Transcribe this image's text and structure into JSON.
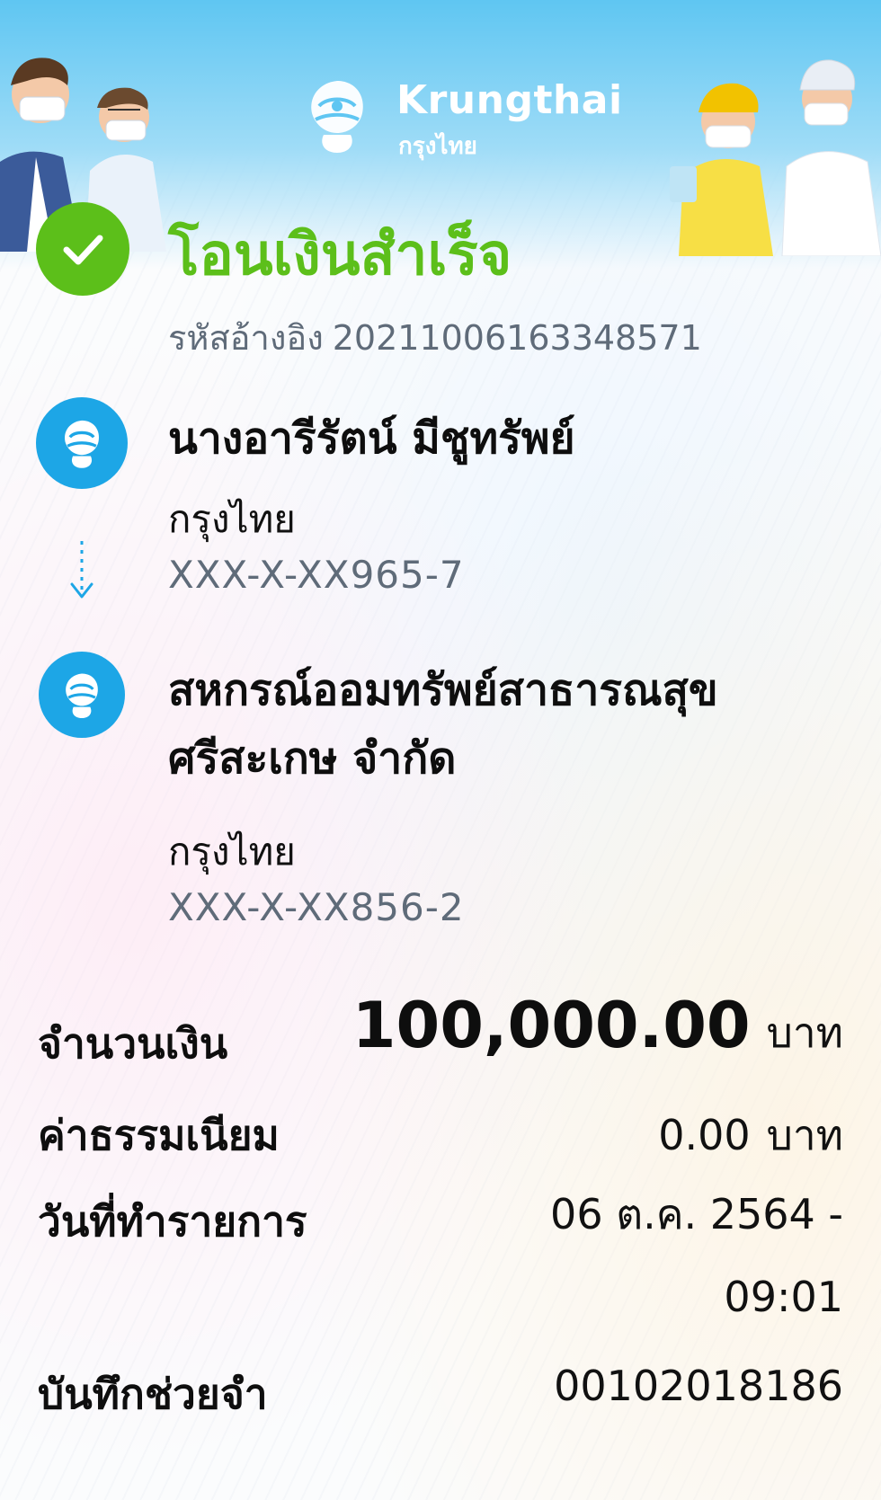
{
  "brand": {
    "name_en": "Krungthai",
    "name_th": "กรุงไทย",
    "color_primary": "#1da6e6",
    "color_success": "#5cbf1a"
  },
  "status": {
    "title": "โอนเงินสำเร็จ",
    "icon": "check-circle-icon"
  },
  "reference": {
    "label": "รหัสอ้างอิง",
    "value": "2021100616334857​1"
  },
  "sender": {
    "name": "นางอารีรัตน์ มีชูทรัพย์",
    "bank": "กรุงไทย",
    "account": "XXX-X-XX965-7",
    "icon": "krungthai-logo-icon"
  },
  "receiver": {
    "name": "สหกรณ์ออมทรัพย์สาธารณสุขศรีสะเกษ จำกัด",
    "bank": "กรุงไทย",
    "account": "XXX-X-XX856-2",
    "icon": "krungthai-logo-icon"
  },
  "details": {
    "amount_label": "จำนวนเงิน",
    "amount_value": "100,000.00",
    "amount_unit": "บาท",
    "fee_label": "ค่าธรรมเนียม",
    "fee_value": "0.00",
    "fee_unit": "บาท",
    "date_label": "วันที่ทำรายการ",
    "date_value": "06 ต.ค. 2564 -",
    "time_value": "09:01",
    "memo_label": "บันทึกช่วยจำ",
    "memo_value": "00102018186"
  }
}
